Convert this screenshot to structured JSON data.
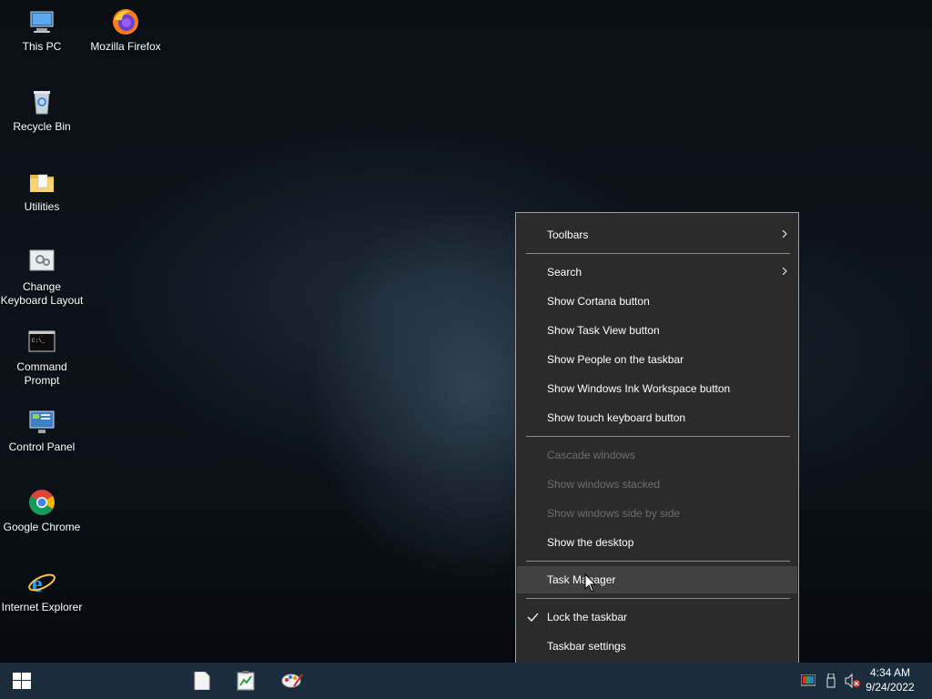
{
  "desktop": {
    "icons": [
      {
        "label": "This PC",
        "icon": "this-pc-icon"
      },
      {
        "label": "Mozilla Firefox",
        "icon": "firefox-icon"
      },
      {
        "label": "Recycle Bin",
        "icon": "recycle-bin-icon"
      },
      {
        "label": "Utilities",
        "icon": "folder-icon"
      },
      {
        "label": "Change Keyboard Layout",
        "icon": "keyboard-layout-icon"
      },
      {
        "label": "Command Prompt",
        "icon": "command-prompt-icon"
      },
      {
        "label": "Control Panel",
        "icon": "control-panel-icon"
      },
      {
        "label": "Google Chrome",
        "icon": "chrome-icon"
      },
      {
        "label": "Internet Explorer",
        "icon": "internet-explorer-icon"
      }
    ]
  },
  "context_menu": {
    "toolbars": "Toolbars",
    "search": "Search",
    "show_cortana": "Show Cortana button",
    "show_task_view": "Show Task View button",
    "show_people": "Show People on the taskbar",
    "show_ink": "Show Windows Ink Workspace button",
    "show_touch_keyboard": "Show touch keyboard button",
    "cascade": "Cascade windows",
    "stacked": "Show windows stacked",
    "side_by_side": "Show windows side by side",
    "show_desktop": "Show the desktop",
    "task_manager": "Task Manager",
    "lock_taskbar": "Lock the taskbar",
    "taskbar_settings": "Taskbar settings"
  },
  "taskbar": {
    "time": "4:34 AM",
    "date": "9/24/2022"
  },
  "colors": {
    "menu_bg": "#2b2b2b",
    "menu_hover": "#414141",
    "taskbar_bg": "#1b2d3c",
    "disabled_text": "#6e6e6e"
  }
}
